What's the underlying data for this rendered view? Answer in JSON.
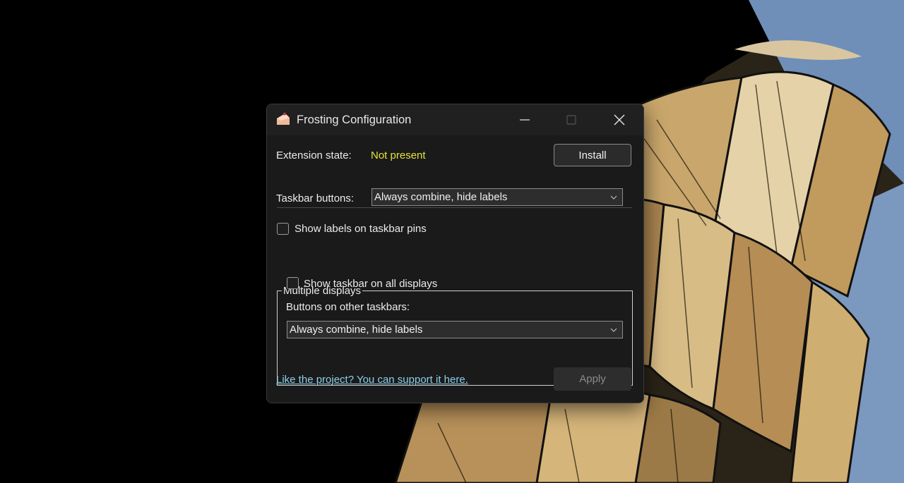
{
  "window": {
    "title": "Frosting Configuration",
    "app_icon": "cake-slice-icon",
    "caption_buttons": [
      "minimize-icon",
      "maximize-icon",
      "close-icon"
    ]
  },
  "extension": {
    "label": "Extension state:",
    "value": "Not present",
    "value_color": "#e6e23c",
    "install_label": "Install"
  },
  "taskbar_buttons": {
    "label": "Taskbar buttons:",
    "selected": "Always combine, hide labels"
  },
  "show_labels_pins": {
    "label": "Show labels on taskbar pins",
    "checked": false
  },
  "multiple_displays": {
    "legend": "Multiple displays",
    "show_all": {
      "label": "Show taskbar on all displays",
      "checked": false
    },
    "other_label": "Buttons on other taskbars:",
    "other_selected": "Always combine, hide labels"
  },
  "footer": {
    "support_link": "Like the project? You can support it here.",
    "apply_label": "Apply",
    "link_color": "#8ecfe8"
  }
}
